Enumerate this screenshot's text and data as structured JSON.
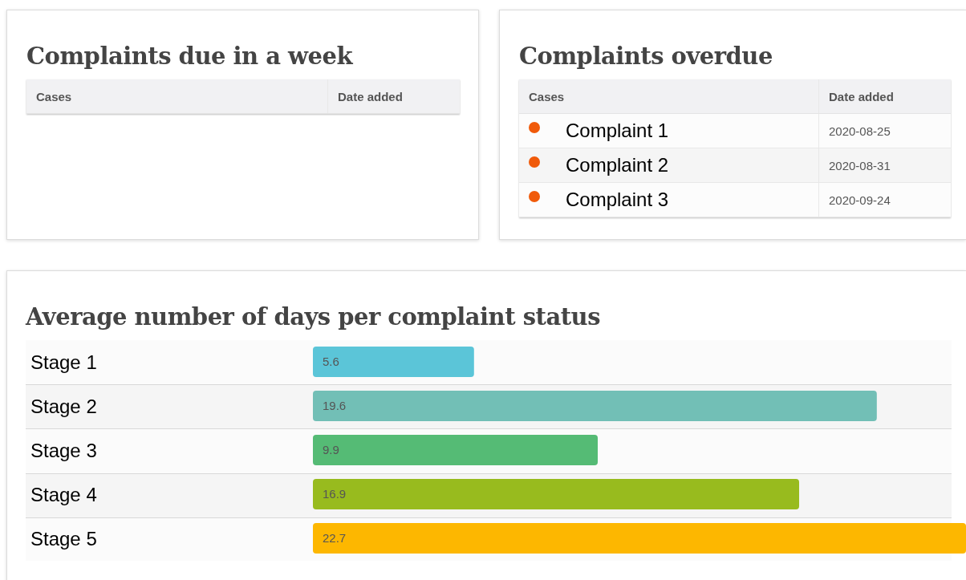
{
  "due_week": {
    "title": "Complaints due in a week",
    "columns": [
      "Cases",
      "Date added"
    ]
  },
  "overdue": {
    "title": "Complaints overdue",
    "columns": [
      "Cases",
      "Date added"
    ],
    "rows": [
      {
        "case": "Complaint 1",
        "date": "2020-08-25",
        "color": "#f05a0a"
      },
      {
        "case": "Complaint 2",
        "date": "2020-08-31",
        "color": "#f05a0a"
      },
      {
        "case": "Complaint 3",
        "date": "2020-09-24",
        "color": "#f05a0a"
      }
    ]
  },
  "status_days": {
    "title": "Average number of days per complaint status",
    "bar_colors": [
      {
        "color": "#5bc5d8"
      },
      {
        "color": "#72bfb6"
      },
      {
        "color": "#55bb75"
      },
      {
        "color": "#98bb1e"
      },
      {
        "color": "#fdb700"
      }
    ],
    "chart_data": {
      "type": "bar",
      "orientation": "horizontal",
      "data_labels": true,
      "categories": [
        "Stage 1",
        "Stage 2",
        "Stage 3",
        "Stage 4",
        "Stage 5"
      ],
      "series": [
        {
          "values": [
            5.6,
            19.6,
            9.9,
            16.9,
            22.7
          ]
        }
      ]
    }
  }
}
